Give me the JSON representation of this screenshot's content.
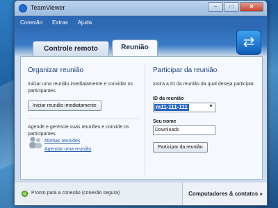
{
  "window": {
    "title": "TeamViewer"
  },
  "menu": {
    "items": [
      "Conexão",
      "Extras",
      "Ajuda"
    ]
  },
  "tabs": [
    {
      "label": "Controle remoto",
      "active": false
    },
    {
      "label": "Reunião",
      "active": true
    }
  ],
  "left": {
    "title": "Organizar reunião",
    "desc": "Iniciar uma reunião imediatamente e convidar os participantes.",
    "start_button": "Iniciar reunião imediatamente",
    "manage_desc": "Agende e gerencie suas reuniões e convide os participantes.",
    "links": [
      "Minhas reuniões",
      "Agendar uma reunião"
    ]
  },
  "right": {
    "title": "Participar da reunião",
    "desc": "Insira a ID da reunião da qual deseja participar.",
    "id_label": "ID da reunião",
    "id_value": "m11-111-111",
    "name_label": "Seu nome",
    "name_value": "Downloads",
    "join_button": "Participar da reunião"
  },
  "status": {
    "text": "Pronto para a conexão (conexão segura)",
    "contacts": "Computadores & contatos »"
  },
  "colors": {
    "menubar": "#2e69b4",
    "accent": "#1d3f7a",
    "status_ok": "#4c9d13"
  }
}
